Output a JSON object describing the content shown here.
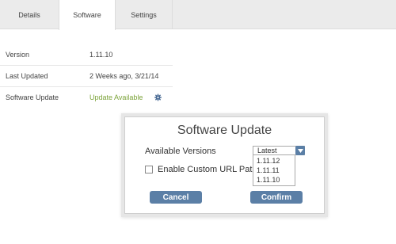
{
  "tabs": [
    {
      "label": "Details"
    },
    {
      "label": "Software"
    },
    {
      "label": "Settings"
    }
  ],
  "info": {
    "rows": [
      {
        "label": "Version",
        "value": "1.11.10"
      },
      {
        "label": "Last Updated",
        "value": "2 Weeks ago, 3/21/14"
      },
      {
        "label": "Software Update",
        "value": "Update Available"
      }
    ]
  },
  "colors": {
    "accent_green": "#7ca33a",
    "button_blue": "#5b7fa6",
    "tab_bar": "#ebebeb"
  },
  "icons": {
    "settings": "gear-icon",
    "dropdown": "chevron-down-icon"
  },
  "modal": {
    "title": "Software Update",
    "available_label": "Available Versions",
    "selected_version": "Latest",
    "options": [
      "1.11.12",
      "1.11.11",
      "1.11.10"
    ],
    "custom_url_label": "Enable Custom URL Path",
    "cancel_label": "Cancel",
    "confirm_label": "Confirm"
  }
}
